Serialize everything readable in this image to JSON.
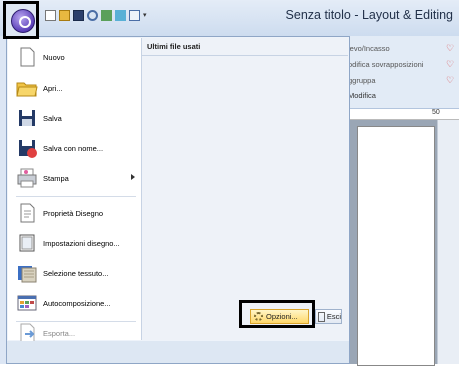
{
  "window": {
    "title": "Senza titolo - Layout & Editing"
  },
  "app_button": {
    "icon": "application-menu-icon"
  },
  "quick_access": [
    "new-file-icon",
    "open-folder-icon",
    "save-icon",
    "zoom-icon",
    "send-icon",
    "import-icon",
    "display-icon",
    "customize-dropdown-icon"
  ],
  "menu": {
    "recent_header": "Ultimi file usati",
    "items": [
      {
        "label": "Nuovo",
        "icon": "new-document-icon"
      },
      {
        "label": "Apri...",
        "icon": "open-folder-icon"
      },
      {
        "label": "Salva",
        "icon": "save-icon"
      },
      {
        "label": "Salva con nome...",
        "icon": "save-as-icon"
      },
      {
        "label": "Stampa",
        "icon": "print-icon"
      },
      {
        "label": "Proprietà Disegno",
        "icon": "design-properties-icon"
      },
      {
        "label": "Impostazioni disegno...",
        "icon": "design-settings-icon"
      },
      {
        "label": "Selezione tessuto...",
        "icon": "fabric-selection-icon"
      },
      {
        "label": "Autocomposizione...",
        "icon": "wizard-icon"
      },
      {
        "label": "Esporta...",
        "icon": "export-icon"
      }
    ],
    "options_label": "Opzioni...",
    "exit_label": "Esci"
  },
  "ribbon": {
    "items": [
      "ievo/Incasso",
      "odifica sovrapposizioni",
      "ggruppa"
    ],
    "group_label": "Modifica"
  },
  "ruler": {
    "label": "50"
  },
  "colors": {
    "accent": "#ffd86a",
    "frame": "#dce6f4",
    "border": "#8fa6c6"
  }
}
